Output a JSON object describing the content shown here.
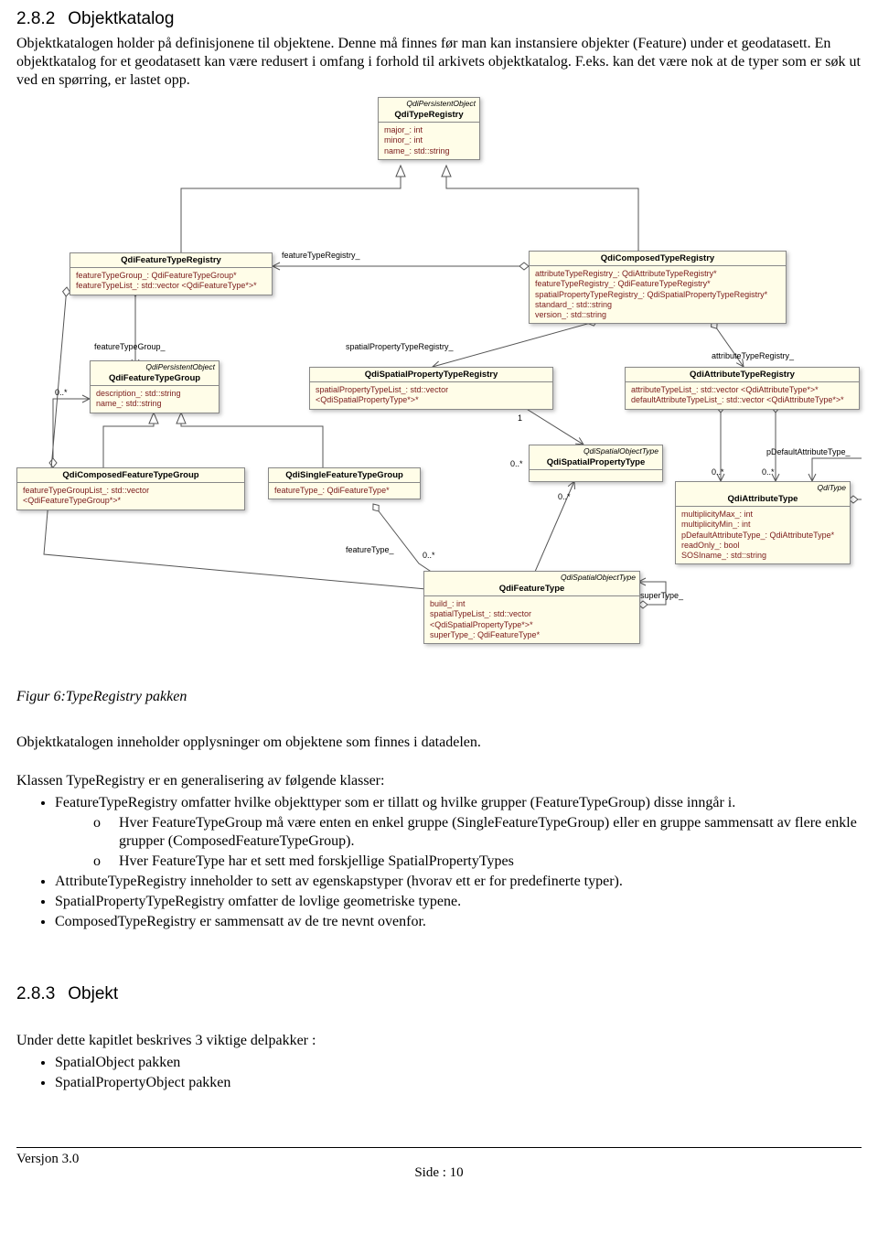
{
  "section1": {
    "num": "2.8.2",
    "title": "Objektkatalog",
    "para": "Objektkatalogen holder på definisjonene til objektene. Denne må finnes før man kan instansiere objekter (Feature) under et geodatasett. En objektkatalog for et geodatasett kan være redusert i omfang i forhold til arkivets objektkatalog. F.eks. kan det  være nok at de typer som er søk ut ved en spørring, er lastet opp."
  },
  "uml": {
    "typeRegistry": {
      "super": "QdiPersistentObject",
      "name": "QdiTypeRegistry",
      "attrs": [
        "major_:  int",
        "minor_:  int",
        "name_:  std::string"
      ]
    },
    "featTypeReg": {
      "name": "QdiFeatureTypeRegistry",
      "attrs": [
        "featureTypeGroup_:  QdiFeatureTypeGroup*",
        "featureTypeList_:  std::vector <QdiFeatureType*>*"
      ]
    },
    "composedTypeReg": {
      "name": "QdiComposedTypeRegistry",
      "attrs": [
        "attributeTypeRegistry_:  QdiAttributeTypeRegistry*",
        "featureTypeRegistry_:  QdiFeatureTypeRegistry*",
        "spatialPropertyTypeRegistry_:  QdiSpatialPropertyTypeRegistry*",
        "standard_:  std::string",
        "version_:  std::string"
      ]
    },
    "featTypeGroup": {
      "super": "QdiPersistentObject",
      "name": "QdiFeatureTypeGroup",
      "attrs": [
        "description_:  std::string",
        "name_:  std::string"
      ]
    },
    "spatPropTypeReg": {
      "name": "QdiSpatialPropertyTypeRegistry",
      "attrs": [
        "spatialPropertyTypeList_:  std::vector <QdiSpatialPropertyType*>*"
      ]
    },
    "attrTypeReg": {
      "name": "QdiAttributeTypeRegistry",
      "attrs": [
        "attributeTypeList_:  std::vector <QdiAttributeType*>*",
        "defaultAttributeTypeList_:  std::vector <QdiAttributeType*>*"
      ]
    },
    "composedFTG": {
      "name": "QdiComposedFeatureTypeGroup",
      "attrs": [
        "featureTypeGroupList_:  std::vector <QdiFeatureTypeGroup*>*"
      ]
    },
    "singleFTG": {
      "name": "QdiSingleFeatureTypeGroup",
      "attrs": [
        "featureType_:  QdiFeatureType*"
      ]
    },
    "spatPropType": {
      "super": "QdiSpatialObjectType",
      "name": "QdiSpatialPropertyType"
    },
    "attrType": {
      "super": "QdiType",
      "name": "QdiAttributeType",
      "attrs": [
        "multiplicityMax_:  int",
        "multiplicityMin_:  int",
        "pDefaultAttributeType_:  QdiAttributeType*",
        "readOnly_:  bool",
        "SOSIname_:  std::string"
      ]
    },
    "featType": {
      "super": "QdiSpatialObjectType",
      "name": "QdiFeatureType",
      "attrs": [
        "build_:  int",
        "spatialTypeList_:  std::vector <QdiSpatialPropertyType*>*",
        "superType_:  QdiFeatureType*"
      ]
    },
    "labels": {
      "featureTypeRegistry": "featureTypeRegistry_",
      "featureTypeGroup": "featureTypeGroup_",
      "spatialPropertyTypeRegistry": "spatialPropertyTypeRegistry_",
      "attributeTypeRegistry": "attributeTypeRegistry_",
      "pDefaultAttributeType": "pDefaultAttributeType_",
      "featureType": "featureType_",
      "superType": "superType_"
    }
  },
  "figcap": "Figur 6:TypeRegistry pakken",
  "p_after_fig": "Objektkatalogen inneholder opplysninger om objektene som finnes i datadelen.",
  "p_klassen": "Klassen TypeRegistry er en generalisering av følgende klasser:",
  "bullets1": {
    "b1": "FeatureTypeRegistry omfatter hvilke objekttyper som er tillatt og hvilke grupper (FeatureTypeGroup)  disse inngår i.",
    "b1a": "Hver FeatureTypeGroup må være enten en enkel gruppe (SingleFeatureTypeGroup) eller en gruppe sammensatt av flere enkle grupper (ComposedFeatureTypeGroup).",
    "b1b": "Hver FeatureType har et sett med forskjellige SpatialPropertyTypes",
    "b2": "AttributeTypeRegistry inneholder to sett av egenskapstyper (hvorav ett er for predefinerte typer).",
    "b3": "SpatialPropertyTypeRegistry omfatter de lovlige geometriske typene.",
    "b4": "ComposedTypeRegistry er sammensatt av de tre nevnt ovenfor."
  },
  "section2": {
    "num": "2.8.3",
    "title": "Objekt"
  },
  "p_under": "Under dette kapitlet beskrives 3 viktige delpakker :",
  "bullets2": {
    "b1": "SpatialObject pakken",
    "b2": "SpatialPropertyObject pakken"
  },
  "footer": {
    "version": "Versjon 3.0",
    "page": "Side : 10"
  }
}
